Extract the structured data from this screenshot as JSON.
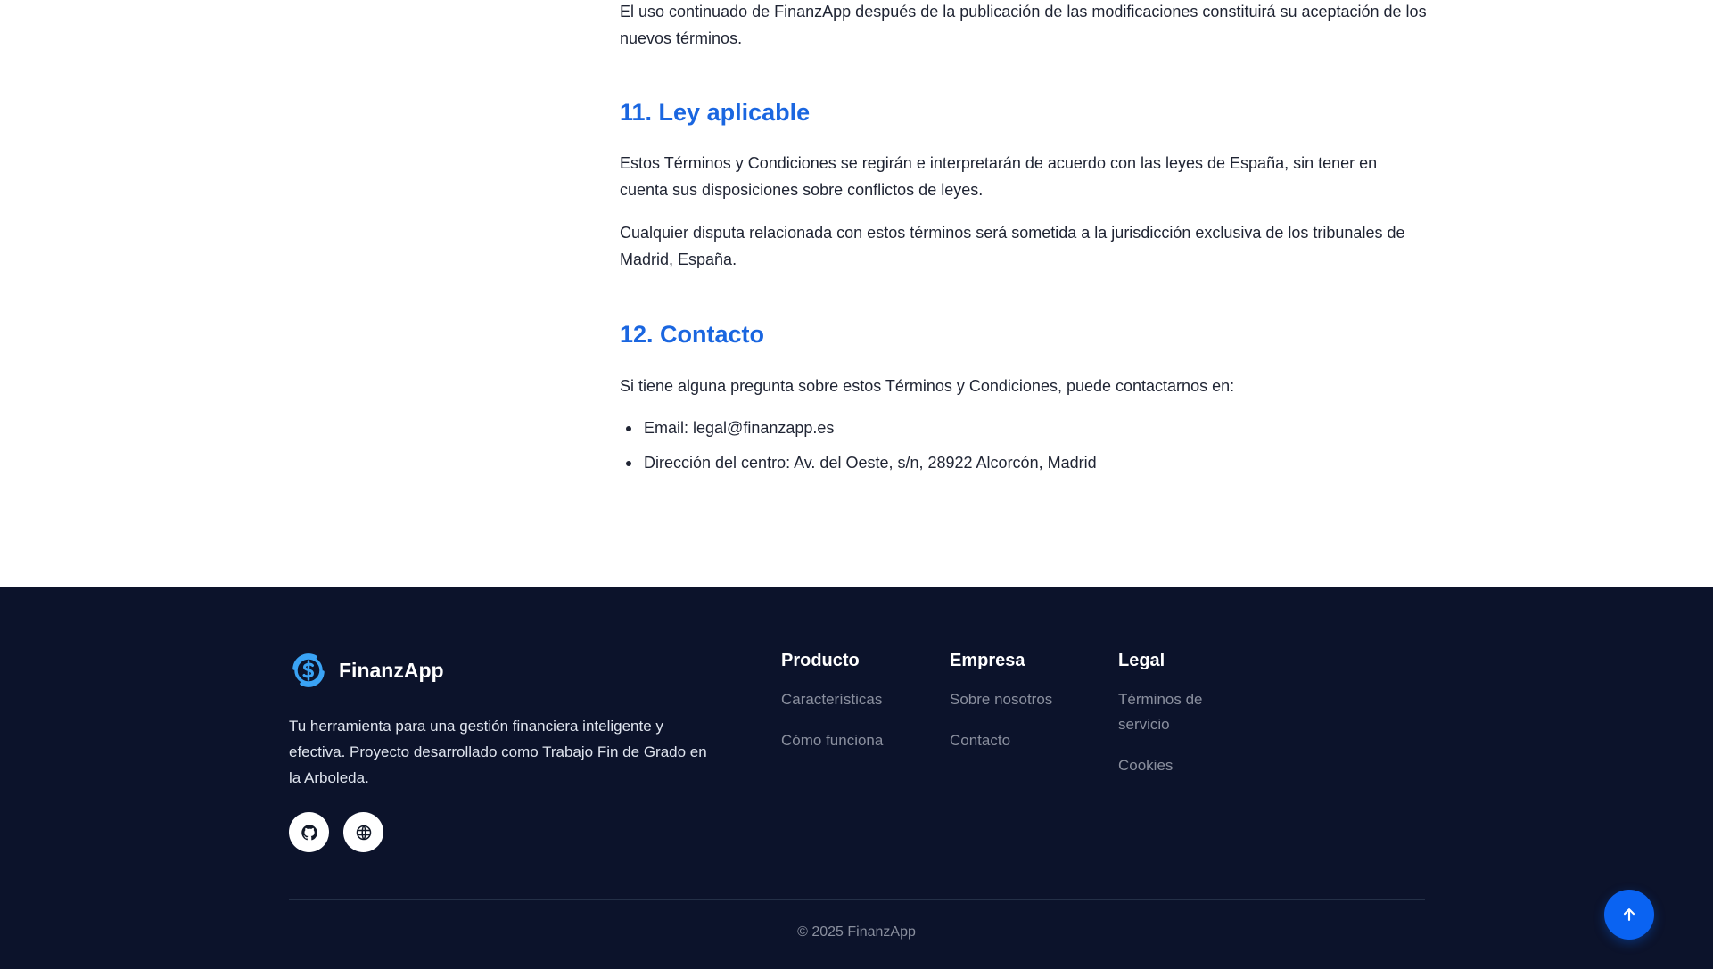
{
  "content": {
    "intro_paragraph": "El uso continuado de FinanzApp después de la publicación de las modificaciones constituirá su aceptación de los nuevos términos.",
    "section_11": {
      "title": "11. Ley aplicable",
      "paragraph_1": "Estos Términos y Condiciones se regirán e interpretarán de acuerdo con las leyes de España, sin tener en cuenta sus disposiciones sobre conflictos de leyes.",
      "paragraph_2": "Cualquier disputa relacionada con estos términos será sometida a la jurisdicción exclusiva de los tribunales de Madrid, España."
    },
    "section_12": {
      "title": "12. Contacto",
      "paragraph": "Si tiene alguna pregunta sobre estos Términos y Condiciones, puede contactarnos en:",
      "items": [
        "Email: legal@finanzapp.es",
        "Dirección del centro: Av. del Oeste, s/n, 28922 Alcorcón, Madrid"
      ]
    }
  },
  "footer": {
    "brand_name": "FinanzApp",
    "description": "Tu herramienta para una gestión financiera inteligente y efectiva. Proyecto desarrollado como Trabajo Fin de Grado en la Arboleda.",
    "social": [
      {
        "icon": "github-icon"
      },
      {
        "icon": "globe-icon"
      }
    ],
    "columns": {
      "producto": {
        "title": "Producto",
        "links": [
          "Características",
          "Cómo funciona"
        ]
      },
      "empresa": {
        "title": "Empresa",
        "links": [
          "Sobre nosotros",
          "Contacto"
        ]
      },
      "legal": {
        "title": "Legal",
        "links": [
          "Términos de servicio",
          "Cookies"
        ]
      }
    },
    "copyright": "© 2025 FinanzApp"
  },
  "back_to_top": {
    "icon": "arrow-up-icon"
  },
  "colors": {
    "heading_blue": "#1a66e0",
    "footer_bg": "#0c132b",
    "accent_button": "#0a63f2"
  }
}
